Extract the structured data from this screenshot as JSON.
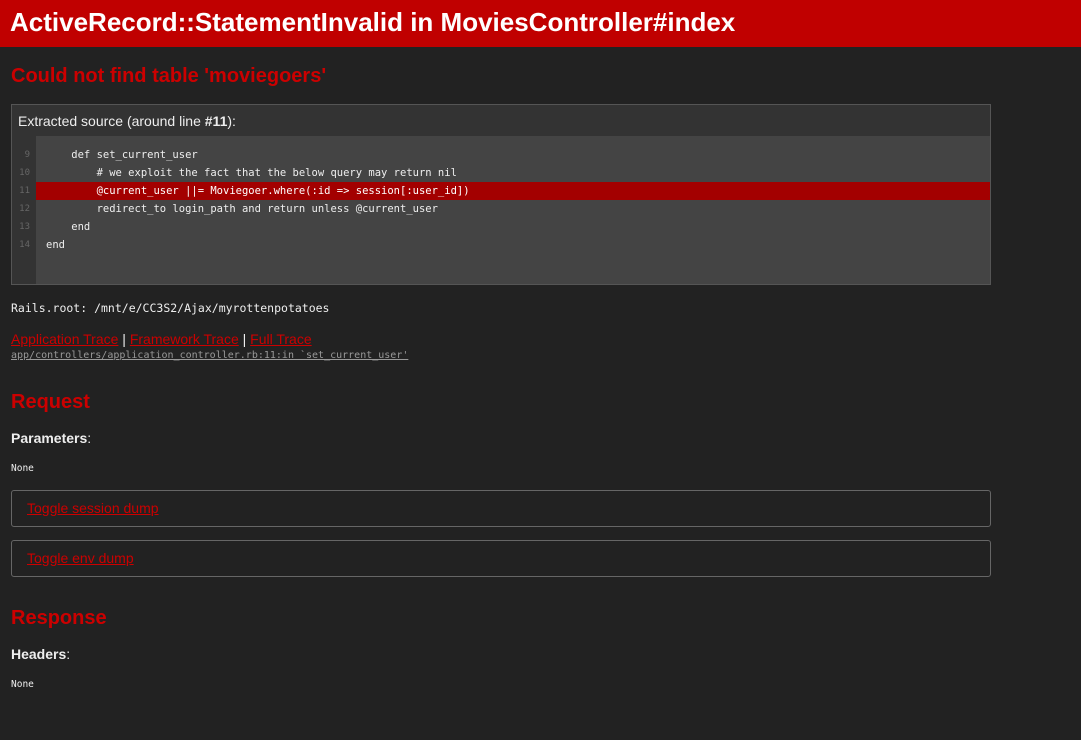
{
  "header": {
    "title": "ActiveRecord::StatementInvalid in MoviesController#index"
  },
  "error": {
    "message": "Could not find table 'moviegoers'"
  },
  "source": {
    "title_prefix": "Extracted source (around line ",
    "title_line": "#11",
    "title_suffix": "):",
    "lines": [
      {
        "num": "9",
        "code": "    def set_current_user"
      },
      {
        "num": "10",
        "code": "        # we exploit the fact that the below query may return nil"
      },
      {
        "num": "11",
        "code": "        @current_user ||= Moviegoer.where(:id => session[:user_id])"
      },
      {
        "num": "12",
        "code": "        redirect_to login_path and return unless @current_user"
      },
      {
        "num": "13",
        "code": "    end"
      },
      {
        "num": "14",
        "code": "end"
      }
    ]
  },
  "rails_root": "Rails.root: /mnt/e/CC3S2/Ajax/myrottenpotatoes",
  "trace": {
    "application": "Application Trace",
    "framework": "Framework Trace",
    "full": "Full Trace",
    "separator": "|",
    "path": "app/controllers/application_controller.rb:11:in `set_current_user'"
  },
  "request": {
    "heading": "Request",
    "params_label": "Parameters",
    "params_value": "None",
    "toggle_session": "Toggle session dump",
    "toggle_env": "Toggle env dump"
  },
  "response": {
    "heading": "Response",
    "headers_label": "Headers",
    "headers_value": "None"
  },
  "colors": {
    "accent": "#cc0000",
    "header_bg": "#c00000",
    "highlight_line": "#a30000",
    "background": "#222222"
  }
}
